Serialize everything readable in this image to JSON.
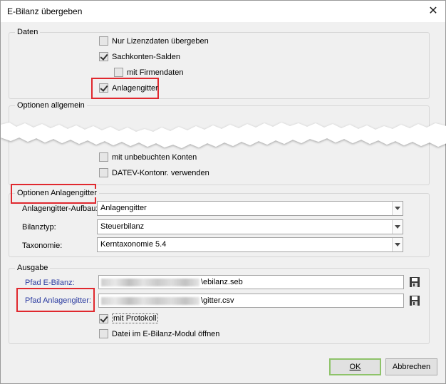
{
  "window": {
    "title": "E-Bilanz übergeben",
    "close_glyph": "✕"
  },
  "daten": {
    "label": "Daten",
    "items": [
      {
        "label": "Nur Lizenzdaten übergeben",
        "checked": false
      },
      {
        "label": "Sachkonten-Salden",
        "checked": true
      },
      {
        "label": "mit Firmendaten",
        "checked": false
      },
      {
        "label": "Anlagengitter",
        "checked": true
      }
    ]
  },
  "optionen_allgemein": {
    "label": "Optionen allgemein",
    "items": [
      {
        "label": "mit unbebuchten Konten",
        "checked": false
      },
      {
        "label": "DATEV-Kontonr. verwenden",
        "checked": false
      }
    ]
  },
  "optionen_anlagengitter": {
    "label": "Optionen Anlagengitter",
    "fields": [
      {
        "label": "Anlagengitter-Aufbau:",
        "value": "Anlagengitter"
      },
      {
        "label": "Bilanztyp:",
        "value": "Steuerbilanz"
      },
      {
        "label": "Taxonomie:",
        "value": "Kerntaxonomie 5.4"
      }
    ]
  },
  "ausgabe": {
    "label": "Ausgabe",
    "pfad_ebilanz_label": "Pfad E-Bilanz:",
    "pfad_ebilanz_value": "\\ebilanz.seb",
    "pfad_anlagengitter_label": "Pfad Anlagengitter:",
    "pfad_anlagengitter_value": "\\gitter.csv",
    "mit_protokoll_label": "mit Protokoll",
    "datei_oeffnen_label": "Datei im E-Bilanz-Modul öffnen"
  },
  "buttons": {
    "ok": "OK",
    "abbrechen": "Abbrechen"
  },
  "colors": {
    "highlight": "#e0282e",
    "default_button_border": "#8ec36a",
    "link_label": "#2a3aa0"
  },
  "icons": {
    "save": "floppy-disk-icon",
    "dropdown": "chevron-down-icon",
    "close": "close-icon"
  }
}
